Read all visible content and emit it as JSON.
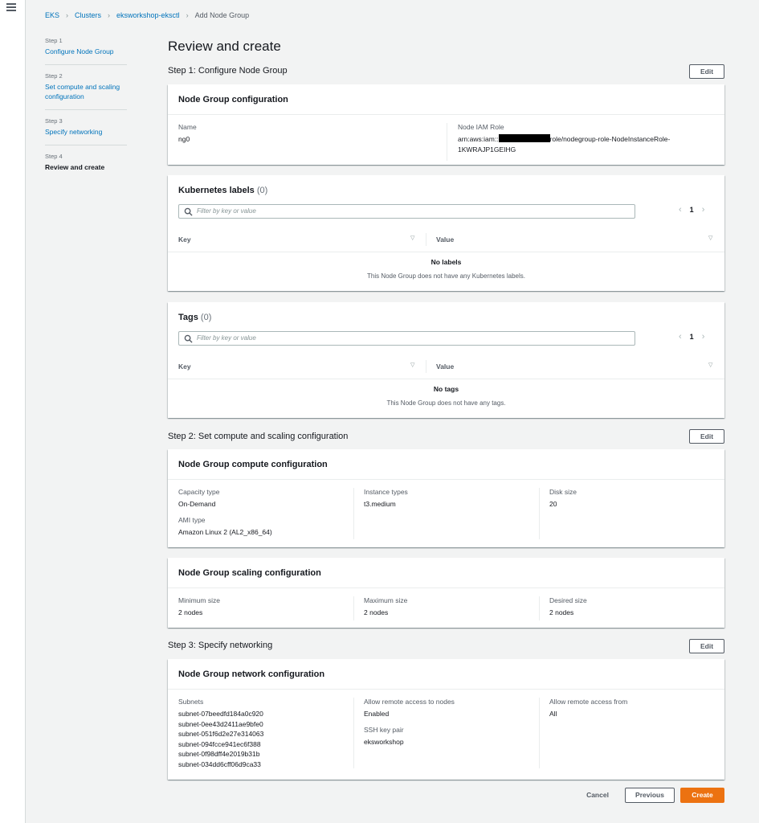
{
  "breadcrumb": {
    "items": [
      "EKS",
      "Clusters",
      "eksworkshop-eksctl"
    ],
    "current": "Add Node Group"
  },
  "steps": [
    {
      "num": "Step 1",
      "label": "Configure Node Group"
    },
    {
      "num": "Step 2",
      "label": "Set compute and scaling configuration"
    },
    {
      "num": "Step 3",
      "label": "Specify networking"
    },
    {
      "num": "Step 4",
      "label": "Review and create"
    }
  ],
  "page_title": "Review and create",
  "edit_label": "Edit",
  "section1": {
    "heading": "Step 1: Configure Node Group",
    "config": {
      "title": "Node Group configuration",
      "name_label": "Name",
      "name_value": "ng0",
      "role_label": "Node IAM Role",
      "role_prefix": "arn:aws:iam::",
      "role_suffix": "role/nodegroup-role-NodeInstanceRole-",
      "role_line2": "1KWRAJP1GEIHG"
    },
    "k8s_labels": {
      "title": "Kubernetes labels",
      "count": "(0)",
      "filter_placeholder": "Filter by key or value",
      "page": "1",
      "col_key": "Key",
      "col_value": "Value",
      "empty_title": "No labels",
      "empty_text": "This Node Group does not have any Kubernetes labels."
    },
    "tags": {
      "title": "Tags",
      "count": "(0)",
      "filter_placeholder": "Filter by key or value",
      "page": "1",
      "col_key": "Key",
      "col_value": "Value",
      "empty_title": "No tags",
      "empty_text": "This Node Group does not have any tags."
    }
  },
  "section2": {
    "heading": "Step 2: Set compute and scaling configuration",
    "compute": {
      "title": "Node Group compute configuration",
      "capacity_label": "Capacity type",
      "capacity_value": "On-Demand",
      "ami_label": "AMI type",
      "ami_value": "Amazon Linux 2 (AL2_x86_64)",
      "instance_label": "Instance types",
      "instance_value": "t3.medium",
      "disk_label": "Disk size",
      "disk_value": "20"
    },
    "scaling": {
      "title": "Node Group scaling configuration",
      "min_label": "Minimum size",
      "min_value": "2 nodes",
      "max_label": "Maximum size",
      "max_value": "2 nodes",
      "desired_label": "Desired size",
      "desired_value": "2 nodes"
    }
  },
  "section3": {
    "heading": "Step 3: Specify networking",
    "network": {
      "title": "Node Group network configuration",
      "subnets_label": "Subnets",
      "subnets": [
        "subnet-07beedfd184a0c920",
        "subnet-0ee43d2411ae9bfe0",
        "subnet-051f6d2e27e314063",
        "subnet-094fcce941ec6f388",
        "subnet-0f98dff4e2019b31b",
        "subnet-034dd6cff06d9ca33"
      ],
      "remote_label": "Allow remote access to nodes",
      "remote_value": "Enabled",
      "ssh_label": "SSH key pair",
      "ssh_value": "eksworkshop",
      "from_label": "Allow remote access from",
      "from_value": "All"
    }
  },
  "footer": {
    "cancel": "Cancel",
    "previous": "Previous",
    "create": "Create"
  },
  "colors": {
    "link": "#0073bb",
    "primary": "#ec7211",
    "background": "#f2f3f3"
  }
}
